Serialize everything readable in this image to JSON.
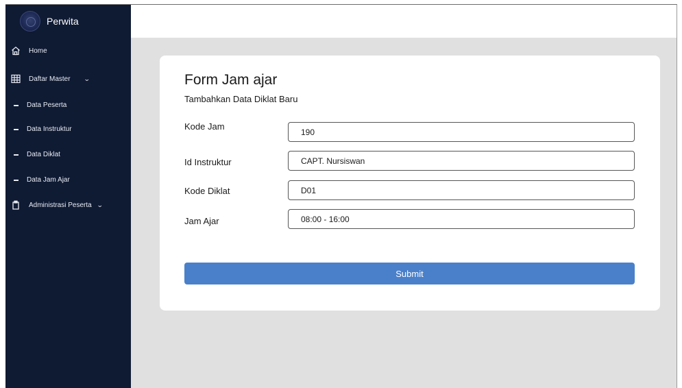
{
  "app": {
    "brand": "Perwita"
  },
  "sidebar": {
    "items": [
      {
        "label": "Home",
        "icon": "home-icon"
      },
      {
        "label": "Daftar Master",
        "icon": "grid-icon",
        "expandable": true
      },
      {
        "label": "Data Peserta",
        "sub": true
      },
      {
        "label": "Data Instruktur",
        "sub": true
      },
      {
        "label": "Data Diklat",
        "sub": true
      },
      {
        "label": "Data Jam Ajar",
        "sub": true
      },
      {
        "label": "Administrasi Peserta",
        "icon": "clipboard-icon",
        "expandable": true
      }
    ]
  },
  "form": {
    "title": "Form Jam ajar",
    "subtitle": "Tambahkan Data Diklat Baru",
    "fields": [
      {
        "label": "Kode Jam",
        "value": "190"
      },
      {
        "label": "Id Instruktur",
        "value": "CAPT. Nursiswan"
      },
      {
        "label": "Kode Diklat",
        "value": "D01"
      },
      {
        "label": "Jam Ajar",
        "value": "08:00 - 16:00"
      }
    ],
    "submit_label": "Submit"
  },
  "colors": {
    "sidebar_bg": "#0f1a33",
    "content_bg": "#e0e0e0",
    "accent": "#4a80c9"
  }
}
